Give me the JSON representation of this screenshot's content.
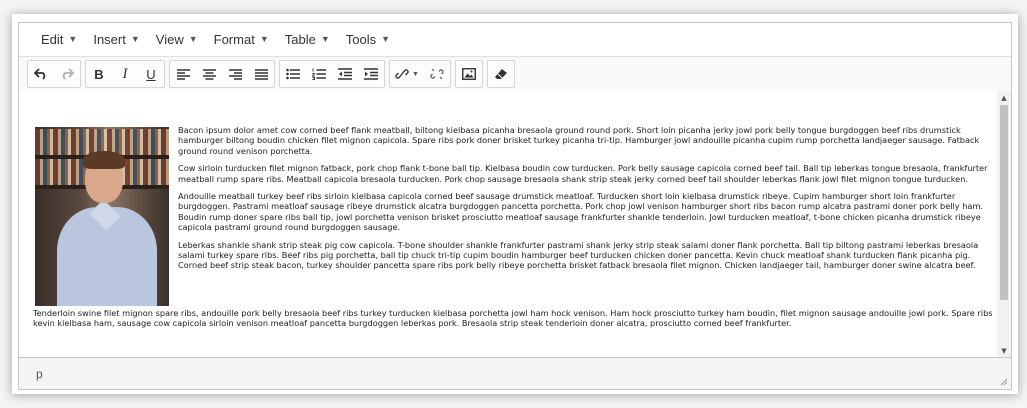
{
  "menubar": {
    "items": [
      {
        "label": "Edit"
      },
      {
        "label": "Insert"
      },
      {
        "label": "View"
      },
      {
        "label": "Format"
      },
      {
        "label": "Table"
      },
      {
        "label": "Tools"
      }
    ]
  },
  "toolbar": {
    "bold": "B",
    "italic": "I",
    "underline": "U"
  },
  "content": {
    "paragraphs": [
      "Bacon ipsum dolor amet cow corned beef flank meatball, biltong kielbasa picanha bresaola ground round pork. Short loin picanha jerky jowl pork belly tongue burgdoggen beef ribs drumstick hamburger biltong boudin chicken filet mignon capicola. Spare ribs pork doner brisket turkey picanha tri-tip. Hamburger jowl andouille picanha cupim rump porchetta landjaeger sausage. Fatback ground round venison porchetta.",
      "Cow sirloin turducken filet mignon fatback, pork chop flank t-bone ball tip. Kielbasa boudin cow turducken. Pork belly sausage capicola corned beef tail. Ball tip leberkas tongue bresaola, frankfurter meatball rump spare ribs. Meatball capicola bresaola turducken. Pork chop sausage bresaola shank strip steak jerky corned beef tail shoulder leberkas flank jowl filet mignon tongue turducken.",
      "Andouille meatball turkey beef ribs sirloin kielbasa capicola corned beef sausage drumstick meatloaf. Turducken short loin kielbasa drumstick ribeye. Cupim hamburger short loin frankfurter burgdoggen. Pastrami meatloaf sausage ribeye drumstick alcatra burgdoggen pancetta porchetta. Pork chop jowl venison hamburger short ribs bacon rump alcatra pastrami doner pork belly ham. Boudin rump doner spare ribs ball tip, jowl porchetta venison brisket prosciutto meatloaf sausage frankfurter shankle tenderloin. Jowl turducken meatloaf, t-bone chicken picanha drumstick ribeye capicola pastrami ground round burgdoggen sausage.",
      "Leberkas shankle shank strip steak pig cow capicola. T-bone shoulder shankle frankfurter pastrami shank jerky strip steak salami doner flank porchetta. Ball tip biltong pastrami leberkas bresaola salami turkey spare ribs. Beef ribs pig porchetta, ball tip chuck tri-tip cupim boudin hamburger beef turducken chicken doner pancetta. Kevin chuck meatloaf shank turducken flank picanha pig. Corned beef strip steak bacon, turkey shoulder pancetta spare ribs pork belly ribeye porchetta brisket fatback bresaola filet mignon. Chicken landjaeger tail, hamburger doner swine alcatra beef.",
      "Tenderloin swine filet mignon spare ribs, andouille pork belly bresaola beef ribs turkey turducken kielbasa porchetta jowl ham hock venison. Ham hock prosciutto turkey ham boudin, filet mignon sausage andouille jowl pork. Spare ribs kevin kielbasa ham, sausage cow capicola sirloin venison meatloaf pancetta burgdoggen leberkas pork. Bresaola strip steak tenderloin doner alcatra, prosciutto corned beef frankfurter."
    ]
  },
  "statusbar": {
    "path": "p"
  }
}
